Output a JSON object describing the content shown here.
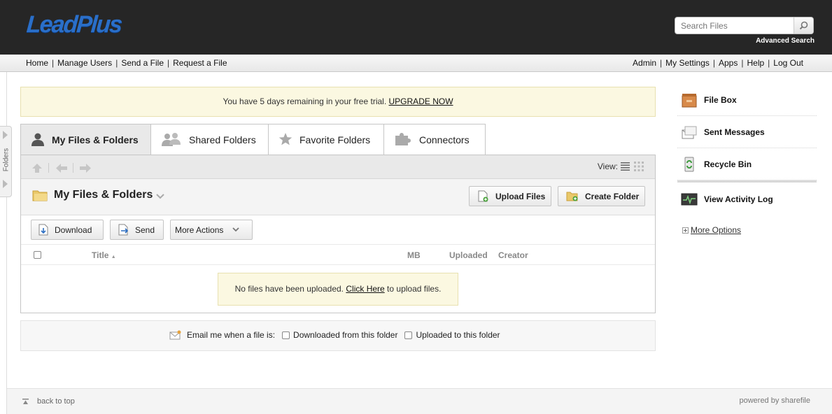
{
  "header": {
    "logo_text": "LeadPlus",
    "search_placeholder": "Search Files",
    "advanced_search": "Advanced Search"
  },
  "nav": {
    "left": [
      "Home",
      "Manage Users",
      "Send a File",
      "Request a File"
    ],
    "right": [
      "Admin",
      "My Settings",
      "Apps",
      "Help",
      "Log Out"
    ]
  },
  "folders_tab": {
    "label": "Folders"
  },
  "trial_banner": {
    "text": "You have 5 days remaining in your free trial.",
    "link": "UPGRADE NOW"
  },
  "tabs": [
    {
      "label": "My Files & Folders",
      "icon": "user-icon",
      "active": true
    },
    {
      "label": "Shared Folders",
      "icon": "users-icon",
      "active": false
    },
    {
      "label": "Favorite Folders",
      "icon": "star-icon",
      "active": false
    },
    {
      "label": "Connectors",
      "icon": "puzzle-icon",
      "active": false
    }
  ],
  "panel": {
    "view_label": "View:",
    "folder_title": "My Files & Folders",
    "upload_files": "Upload Files",
    "create_folder": "Create Folder",
    "download": "Download",
    "send": "Send",
    "more_actions": "More Actions",
    "columns": {
      "title": "Title",
      "mb": "MB",
      "uploaded": "Uploaded",
      "creator": "Creator"
    },
    "empty_message": {
      "before": "No files have been uploaded.",
      "link": "Click Here",
      "after": "to upload files."
    }
  },
  "notify": {
    "label": "Email me when a file is:",
    "option_downloaded": "Downloaded from this folder",
    "option_uploaded": "Uploaded to this folder"
  },
  "sidebar": {
    "items": [
      {
        "label": "File Box",
        "icon": "file-box-icon"
      },
      {
        "label": "Sent Messages",
        "icon": "sent-messages-icon"
      },
      {
        "label": "Recycle Bin",
        "icon": "recycle-bin-icon"
      },
      {
        "label": "View Activity Log",
        "icon": "activity-log-icon"
      }
    ],
    "more_options": "More Options"
  },
  "footer": {
    "back_to_top": "back to top",
    "powered_by": "powered by sharefile"
  },
  "colors": {
    "header_bg": "#262626",
    "logo_blue": "#2a6fc9",
    "banner_bg": "#fbf8e1"
  }
}
